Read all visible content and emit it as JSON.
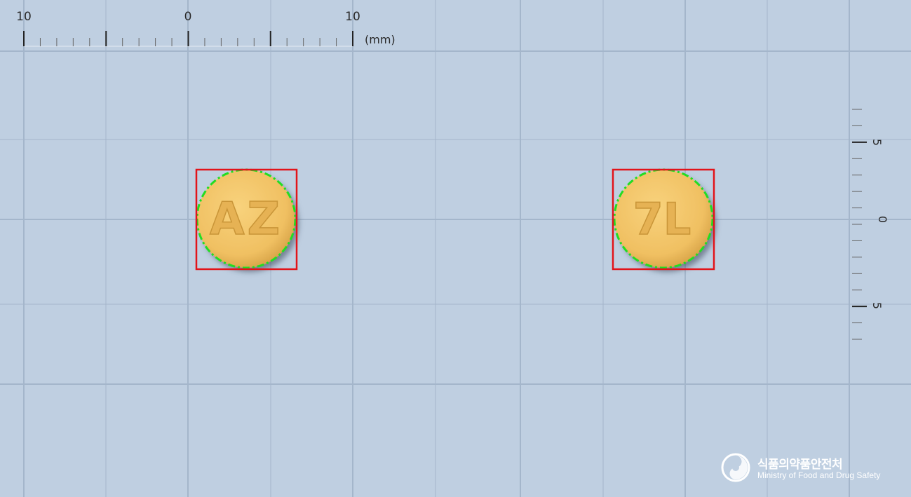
{
  "ruler_top": {
    "labels": [
      "10",
      "0",
      "10"
    ],
    "unit": "(mm)"
  },
  "ruler_right": {
    "labels": [
      "5",
      "0",
      "5"
    ]
  },
  "pills": [
    {
      "imprint": "AZ",
      "color": "#f4c76a"
    },
    {
      "imprint": "7L",
      "color": "#f4c76a"
    }
  ],
  "colors": {
    "background": "#bfcfe1",
    "grid": "#a4b6cb",
    "bounding_box": "#e2141a",
    "contour": "#22dd22"
  },
  "logo": {
    "icon": "mfds-emblem-icon",
    "korean_name": "식품의약품안전처",
    "english_name": "Ministry of Food and Drug Safety"
  }
}
